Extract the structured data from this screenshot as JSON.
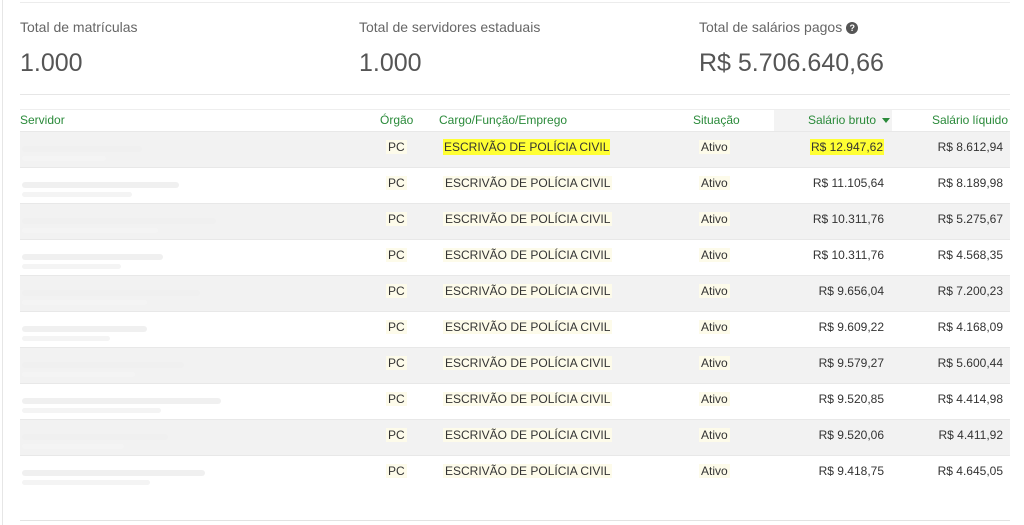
{
  "stats": [
    {
      "label": "Total de matrículas",
      "value": "1.000"
    },
    {
      "label": "Total de servidores estaduais",
      "value": "1.000"
    },
    {
      "label": "Total de salários pagos",
      "value": "R$ 5.706.640,66"
    }
  ],
  "help_icon": "question-circle-icon",
  "table": {
    "headers": {
      "servidor": "Servidor",
      "orgao": "Órgão",
      "cargo": "Cargo/Função/Emprego",
      "situacao": "Situação",
      "bruto": "Salário bruto",
      "liquido": "Salário líquido"
    },
    "sort_icon": "caret-down-icon",
    "rows": [
      {
        "orgao": "PC",
        "cargo": "ESCRIVÃO DE POLÍCIA CIVIL",
        "situacao": "Ativo",
        "bruto": "R$ 12.947,62",
        "liquido": "R$ 8.612,94"
      },
      {
        "orgao": "PC",
        "cargo": "ESCRIVÃO DE POLÍCIA CIVIL",
        "situacao": "Ativo",
        "bruto": "R$ 11.105,64",
        "liquido": "R$ 8.189,98"
      },
      {
        "orgao": "PC",
        "cargo": "ESCRIVÃO DE POLÍCIA CIVIL",
        "situacao": "Ativo",
        "bruto": "R$ 10.311,76",
        "liquido": "R$ 5.275,67"
      },
      {
        "orgao": "PC",
        "cargo": "ESCRIVÃO DE POLÍCIA CIVIL",
        "situacao": "Ativo",
        "bruto": "R$ 10.311,76",
        "liquido": "R$ 4.568,35"
      },
      {
        "orgao": "PC",
        "cargo": "ESCRIVÃO DE POLÍCIA CIVIL",
        "situacao": "Ativo",
        "bruto": "R$ 9.656,04",
        "liquido": "R$ 7.200,23"
      },
      {
        "orgao": "PC",
        "cargo": "ESCRIVÃO DE POLÍCIA CIVIL",
        "situacao": "Ativo",
        "bruto": "R$ 9.609,22",
        "liquido": "R$ 4.168,09"
      },
      {
        "orgao": "PC",
        "cargo": "ESCRIVÃO DE POLÍCIA CIVIL",
        "situacao": "Ativo",
        "bruto": "R$ 9.579,27",
        "liquido": "R$ 5.600,44"
      },
      {
        "orgao": "PC",
        "cargo": "ESCRIVÃO DE POLÍCIA CIVIL",
        "situacao": "Ativo",
        "bruto": "R$ 9.520,85",
        "liquido": "R$ 4.414,98"
      },
      {
        "orgao": "PC",
        "cargo": "ESCRIVÃO DE POLÍCIA CIVIL",
        "situacao": "Ativo",
        "bruto": "R$ 9.520,06",
        "liquido": "R$ 4.411,92"
      },
      {
        "orgao": "PC",
        "cargo": "ESCRIVÃO DE POLÍCIA CIVIL",
        "situacao": "Ativo",
        "bruto": "R$ 9.418,75",
        "liquido": "R$ 4.645,05"
      }
    ]
  },
  "colors": {
    "accent": "#2a8a3a",
    "highlight": "#ffff33"
  }
}
